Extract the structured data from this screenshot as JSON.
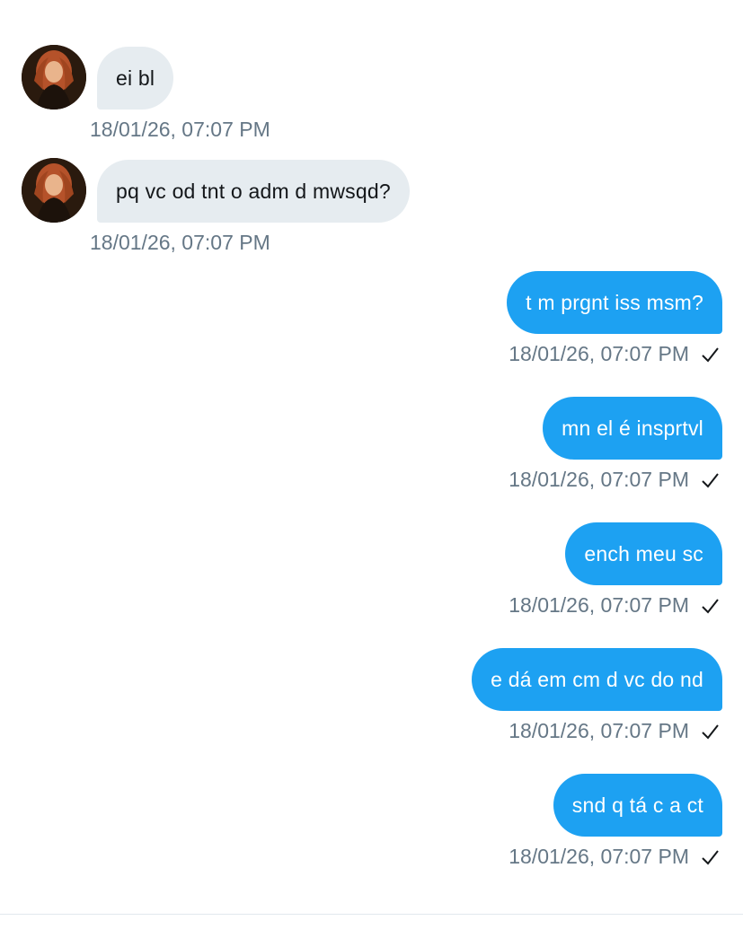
{
  "conversation": {
    "messages": [
      {
        "direction": "incoming",
        "text": "ei bl",
        "timestamp": "18/01/26, 07:07 PM",
        "avatar": "contact-avatar"
      },
      {
        "direction": "incoming",
        "text": "pq vc od tnt o adm d mwsqd?",
        "timestamp": "18/01/26, 07:07 PM",
        "avatar": "contact-avatar"
      },
      {
        "direction": "outgoing",
        "text": "t m prgnt iss msm?",
        "timestamp": "18/01/26, 07:07 PM",
        "status_icon": "check-icon"
      },
      {
        "direction": "outgoing",
        "text": "mn el é insprtvl",
        "timestamp": "18/01/26, 07:07 PM",
        "status_icon": "check-icon"
      },
      {
        "direction": "outgoing",
        "text": "ench meu sc",
        "timestamp": "18/01/26, 07:07 PM",
        "status_icon": "check-icon"
      },
      {
        "direction": "outgoing",
        "text": "e dá em cm d vc do nd",
        "timestamp": "18/01/26, 07:07 PM",
        "status_icon": "check-icon"
      },
      {
        "direction": "outgoing",
        "text": "snd q tá c a ct",
        "timestamp": "18/01/26, 07:07 PM",
        "status_icon": "check-icon"
      }
    ]
  },
  "colors": {
    "incoming_bubble": "#e6ecf0",
    "outgoing_bubble": "#1da1f2",
    "timestamp_text": "#657786"
  }
}
